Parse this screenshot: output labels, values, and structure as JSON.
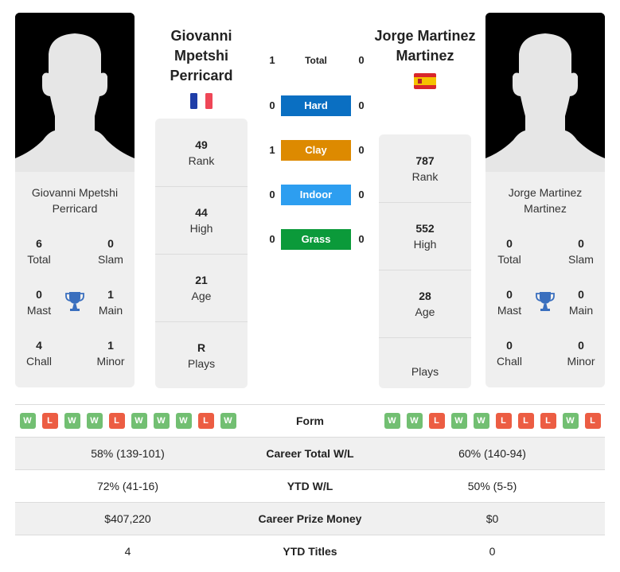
{
  "colors": {
    "hard": "#0a6fc2",
    "clay": "#dd8a00",
    "indoor": "#2d9ef0",
    "grass": "#0b9a3a",
    "win": "#72bf72",
    "loss": "#ec5d43",
    "trophy": "#3a6fbe"
  },
  "player1": {
    "name": "Giovanni Mpetshi Perricard",
    "name_lines": [
      "Giovanni",
      "Mpetshi",
      "Perricard"
    ],
    "card_name_lines": [
      "Giovanni Mpetshi",
      "Perricard"
    ],
    "flag": "france-flag",
    "rank": "49",
    "rank_label": "Rank",
    "high": "44",
    "high_label": "High",
    "age": "21",
    "age_label": "Age",
    "plays": "R",
    "plays_label": "Plays",
    "titles": {
      "total": "6",
      "total_label": "Total",
      "slam": "0",
      "slam_label": "Slam",
      "mast": "0",
      "mast_label": "Mast",
      "main": "1",
      "main_label": "Main",
      "chall": "4",
      "chall_label": "Chall",
      "minor": "1",
      "minor_label": "Minor"
    },
    "form": [
      "W",
      "L",
      "W",
      "W",
      "L",
      "W",
      "W",
      "W",
      "L",
      "W"
    ],
    "career_wl": "58% (139-101)",
    "ytd_wl": "72% (41-16)",
    "prize_money": "$407,220",
    "ytd_titles": "4"
  },
  "player2": {
    "name": "Jorge Martinez Martinez",
    "name_lines": [
      "Jorge Martinez",
      "Martinez"
    ],
    "card_name_lines": [
      "Jorge Martinez",
      "Martinez"
    ],
    "flag": "spain-flag",
    "rank": "787",
    "rank_label": "Rank",
    "high": "552",
    "high_label": "High",
    "age": "28",
    "age_label": "Age",
    "plays": "",
    "plays_label": "Plays",
    "titles": {
      "total": "0",
      "total_label": "Total",
      "slam": "0",
      "slam_label": "Slam",
      "mast": "0",
      "mast_label": "Mast",
      "main": "0",
      "main_label": "Main",
      "chall": "0",
      "chall_label": "Chall",
      "minor": "0",
      "minor_label": "Minor"
    },
    "form": [
      "W",
      "W",
      "L",
      "W",
      "W",
      "L",
      "L",
      "L",
      "W",
      "L"
    ],
    "career_wl": "60% (140-94)",
    "ytd_wl": "50% (5-5)",
    "prize_money": "$0",
    "ytd_titles": "0"
  },
  "h2h": [
    {
      "label": "Total",
      "p1": "1",
      "p2": "0",
      "surface": "total"
    },
    {
      "label": "Hard",
      "p1": "0",
      "p2": "0",
      "surface": "hard"
    },
    {
      "label": "Clay",
      "p1": "1",
      "p2": "0",
      "surface": "clay"
    },
    {
      "label": "Indoor",
      "p1": "0",
      "p2": "0",
      "surface": "indoor"
    },
    {
      "label": "Grass",
      "p1": "0",
      "p2": "0",
      "surface": "grass"
    }
  ],
  "table": {
    "form_label": "Form",
    "career_wl_label": "Career Total W/L",
    "ytd_wl_label": "YTD W/L",
    "prize_label": "Career Prize Money",
    "ytd_titles_label": "YTD Titles"
  }
}
